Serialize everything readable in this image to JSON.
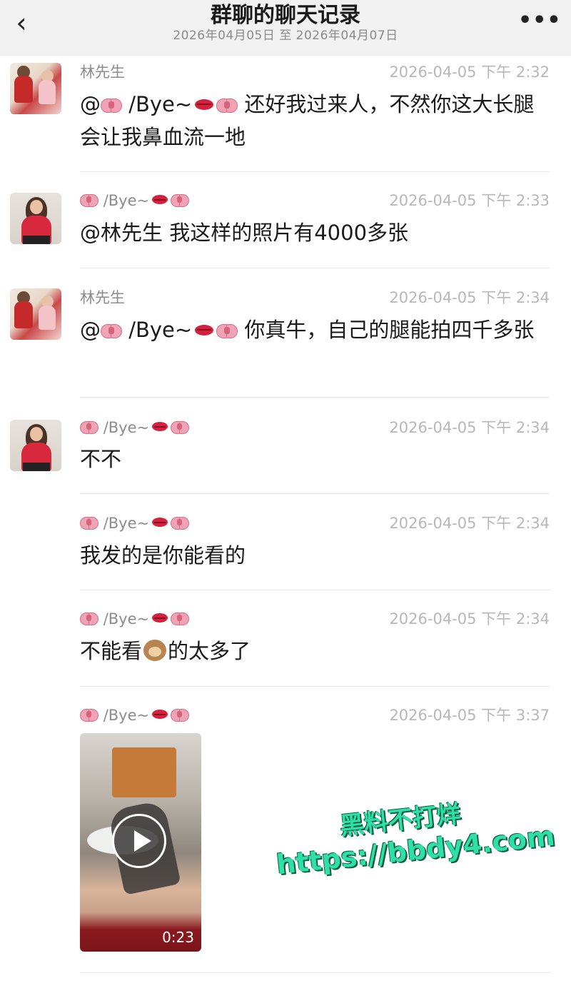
{
  "header": {
    "back_icon": "chevron-left-icon",
    "title": "群聊的聊天记录",
    "subtitle": "2026年04月05日 至 2026年04月07日",
    "more_icon": "more-icon"
  },
  "messages": [
    {
      "sender": "林先生",
      "time": "2026-04-05 下午 2:32",
      "text_before": "@",
      "mention": "/Bye~",
      "text_after": " 还好我过来人，不然你这大长腿会让我鼻血流一地"
    },
    {
      "sender": "/Bye~",
      "time": "2026-04-05 下午 2:33",
      "text": "@林先生 我这样的照片有4000多张"
    },
    {
      "sender": "林先生",
      "time": "2026-04-05 下午 2:34",
      "text_before": "@",
      "mention": "/Bye~",
      "text_after": " 你真牛，自己的腿能拍四千多张"
    },
    {
      "sender": "/Bye~",
      "time": "2026-04-05 下午 2:34",
      "text": "不不"
    },
    {
      "sender": "/Bye~",
      "time": "2026-04-05 下午 2:34",
      "text": "我发的是你能看的"
    },
    {
      "sender": "/Bye~",
      "time": "2026-04-05 下午 2:34",
      "text_before": "不能看",
      "text_after": "的太多了"
    },
    {
      "sender": "/Bye~",
      "time": "2026-04-05 下午 3:37",
      "video_duration": "0:23"
    }
  ],
  "watermark": {
    "line1": "黑料不打烊",
    "line2": "https://bbdy4.com"
  },
  "emoji": {
    "bow": "bow-emoji",
    "lips": "kiss-mark-emoji",
    "monkey": "see-no-evil-monkey-emoji"
  },
  "colors": {
    "background": "#ffffff",
    "header_bg": "#f1f1f1",
    "watermark": "#2ee0a6"
  }
}
